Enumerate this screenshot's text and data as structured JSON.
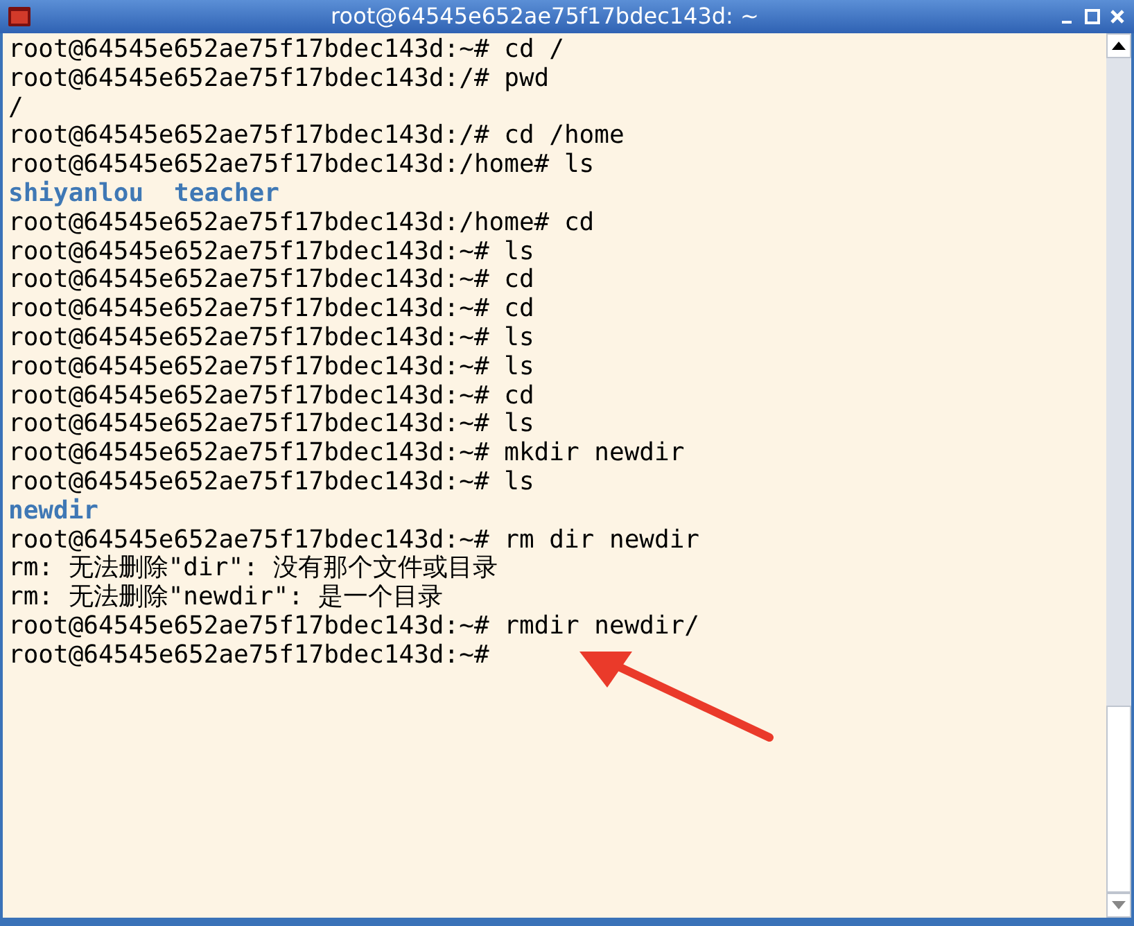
{
  "window": {
    "title": "root@64545e652ae75f17bdec143d: ~"
  },
  "terminal": {
    "lines": [
      {
        "kind": "text",
        "text": "root@64545e652ae75f17bdec143d:~# cd /"
      },
      {
        "kind": "text",
        "text": "root@64545e652ae75f17bdec143d:/# pwd"
      },
      {
        "kind": "text",
        "text": "/"
      },
      {
        "kind": "text",
        "text": "root@64545e652ae75f17bdec143d:/# cd /home"
      },
      {
        "kind": "text",
        "text": "root@64545e652ae75f17bdec143d:/home# ls"
      },
      {
        "kind": "listing",
        "items": [
          "shiyanlou",
          "teacher"
        ]
      },
      {
        "kind": "text",
        "text": "root@64545e652ae75f17bdec143d:/home# cd"
      },
      {
        "kind": "text",
        "text": "root@64545e652ae75f17bdec143d:~# ls"
      },
      {
        "kind": "text",
        "text": "root@64545e652ae75f17bdec143d:~# cd"
      },
      {
        "kind": "text",
        "text": "root@64545e652ae75f17bdec143d:~# cd"
      },
      {
        "kind": "text",
        "text": "root@64545e652ae75f17bdec143d:~# ls"
      },
      {
        "kind": "text",
        "text": "root@64545e652ae75f17bdec143d:~# ls"
      },
      {
        "kind": "text",
        "text": "root@64545e652ae75f17bdec143d:~# cd"
      },
      {
        "kind": "text",
        "text": "root@64545e652ae75f17bdec143d:~# ls"
      },
      {
        "kind": "text",
        "text": "root@64545e652ae75f17bdec143d:~# mkdir newdir"
      },
      {
        "kind": "text",
        "text": "root@64545e652ae75f17bdec143d:~# ls"
      },
      {
        "kind": "listing",
        "items": [
          "newdir"
        ]
      },
      {
        "kind": "text",
        "text": "root@64545e652ae75f17bdec143d:~# rm dir newdir"
      },
      {
        "kind": "text",
        "text": "rm: 无法删除\"dir\": 没有那个文件或目录"
      },
      {
        "kind": "text",
        "text": "rm: 无法删除\"newdir\": 是一个目录"
      },
      {
        "kind": "text",
        "text": "root@64545e652ae75f17bdec143d:~# rmdir newdir/"
      },
      {
        "kind": "text",
        "text": "root@64545e652ae75f17bdec143d:~#"
      }
    ]
  }
}
